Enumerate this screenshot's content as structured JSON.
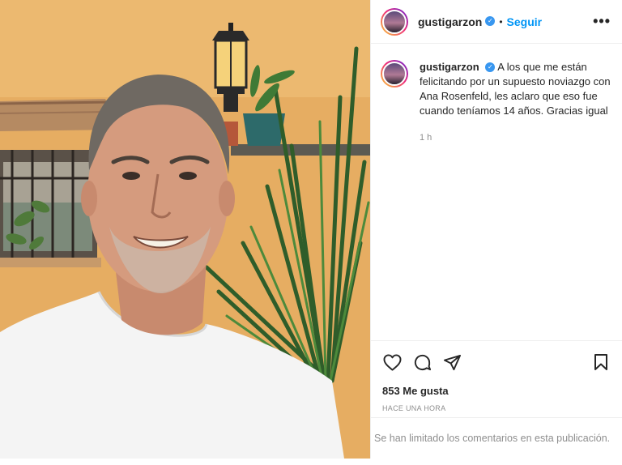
{
  "post": {
    "username": "gustigarzon",
    "follow_label": "Seguir",
    "separator": "•",
    "more_label": "•••",
    "caption_text": "A los que me están felicitando por un supuesto noviazgo con Ana Rosenfeld, les aclaro que eso fue cuando teníamos 14 años. Gracias igual",
    "time_ago": "1 h",
    "likes": "853 Me gusta",
    "timestamp": "HACE UNA HORA",
    "comments_notice": "Se han limitado los comentarios en esta publicación."
  },
  "icons": {
    "verified": "verified-badge-icon",
    "like": "heart-icon",
    "comment": "comment-icon",
    "share": "paper-plane-icon",
    "save": "bookmark-icon",
    "more": "ellipsis-icon"
  },
  "colors": {
    "accent": "#0095f6",
    "verified": "#3897f0",
    "text": "#262626",
    "muted": "#8e8e8e",
    "border": "#efefef"
  }
}
